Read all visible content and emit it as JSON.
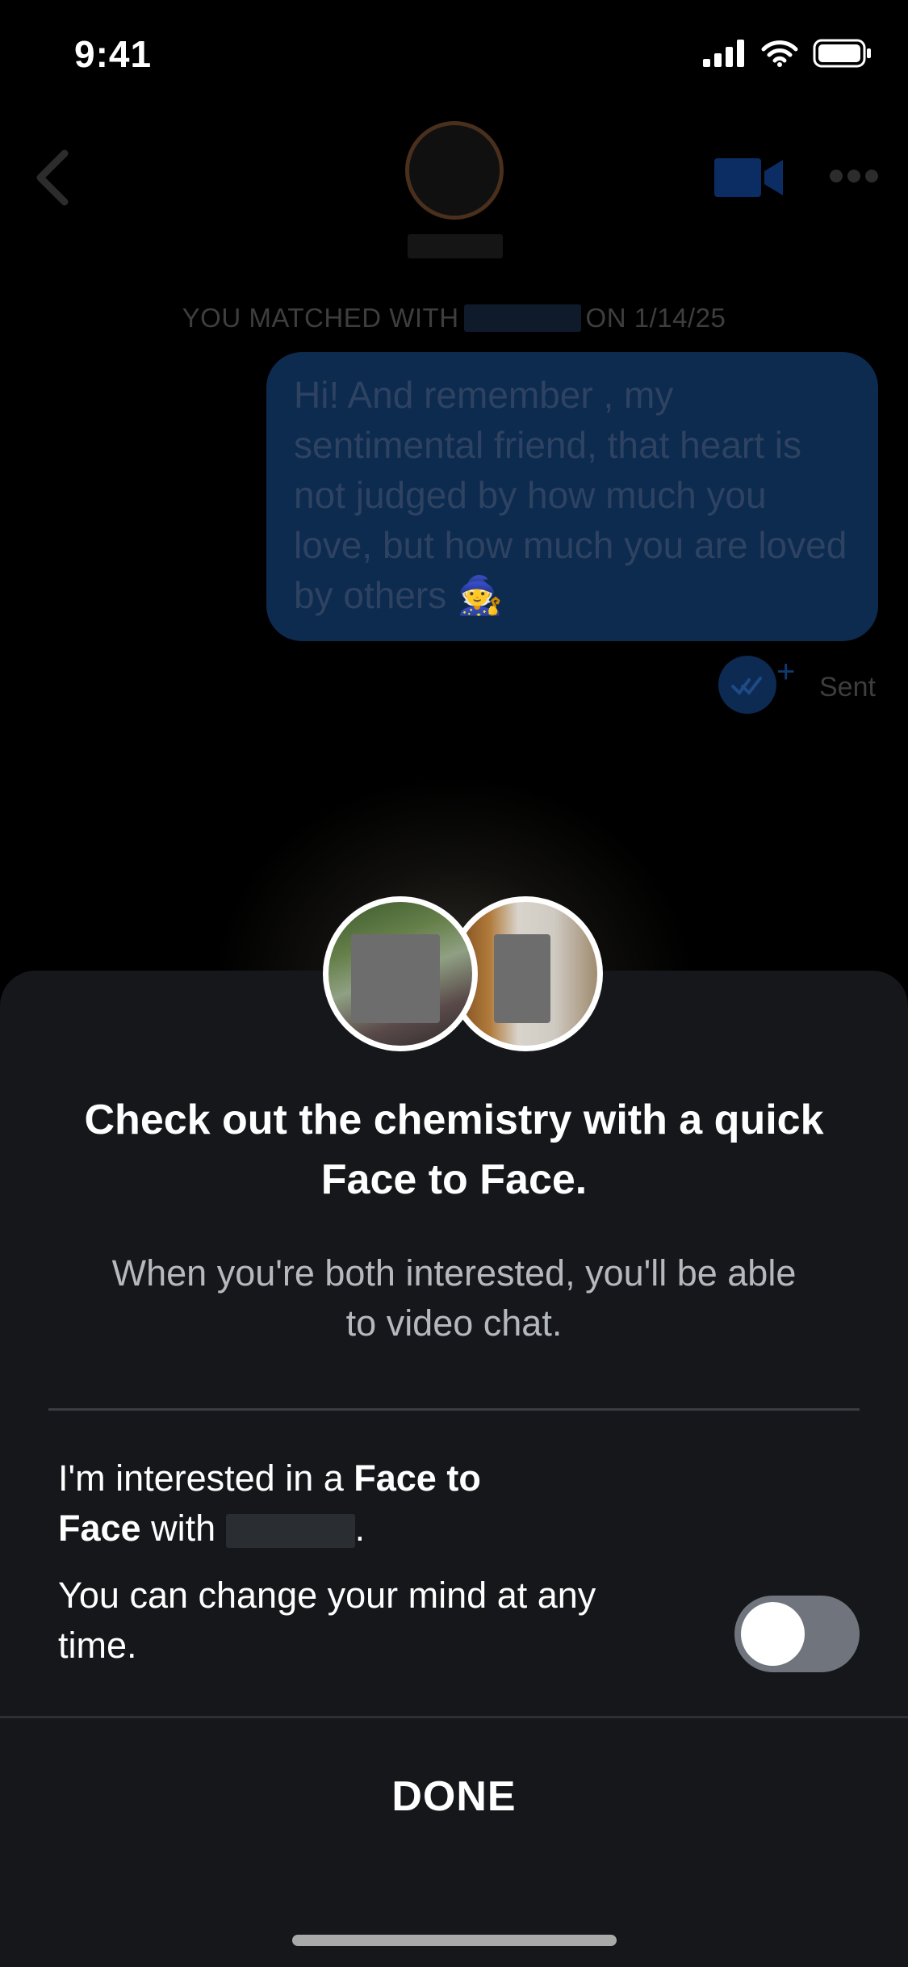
{
  "status_bar": {
    "time": "9:41"
  },
  "chat": {
    "matched_prefix": "YOU MATCHED WITH",
    "matched_suffix": "ON 1/14/25",
    "message": "Hi! And remember , my sentimental friend, that heart is not judged by how much you love, but how much you are loved by others 🧙",
    "sent_label": "Sent"
  },
  "sheet": {
    "title": "Check out the chemistry with a quick Face to Face.",
    "subtitle": "When you're both interested, you'll be able to video chat.",
    "interest_prefix": "I'm interested in a ",
    "interest_bold1": "Face to Face",
    "interest_middle": " with ",
    "interest_suffix": ".",
    "change_mind": "You can change your mind at any time.",
    "toggle_on": false,
    "done_label": "DONE"
  },
  "colors": {
    "sheet_bg": "#15171b",
    "bubble_bg": "#0d2a4f",
    "toggle_off": "#70757d"
  }
}
